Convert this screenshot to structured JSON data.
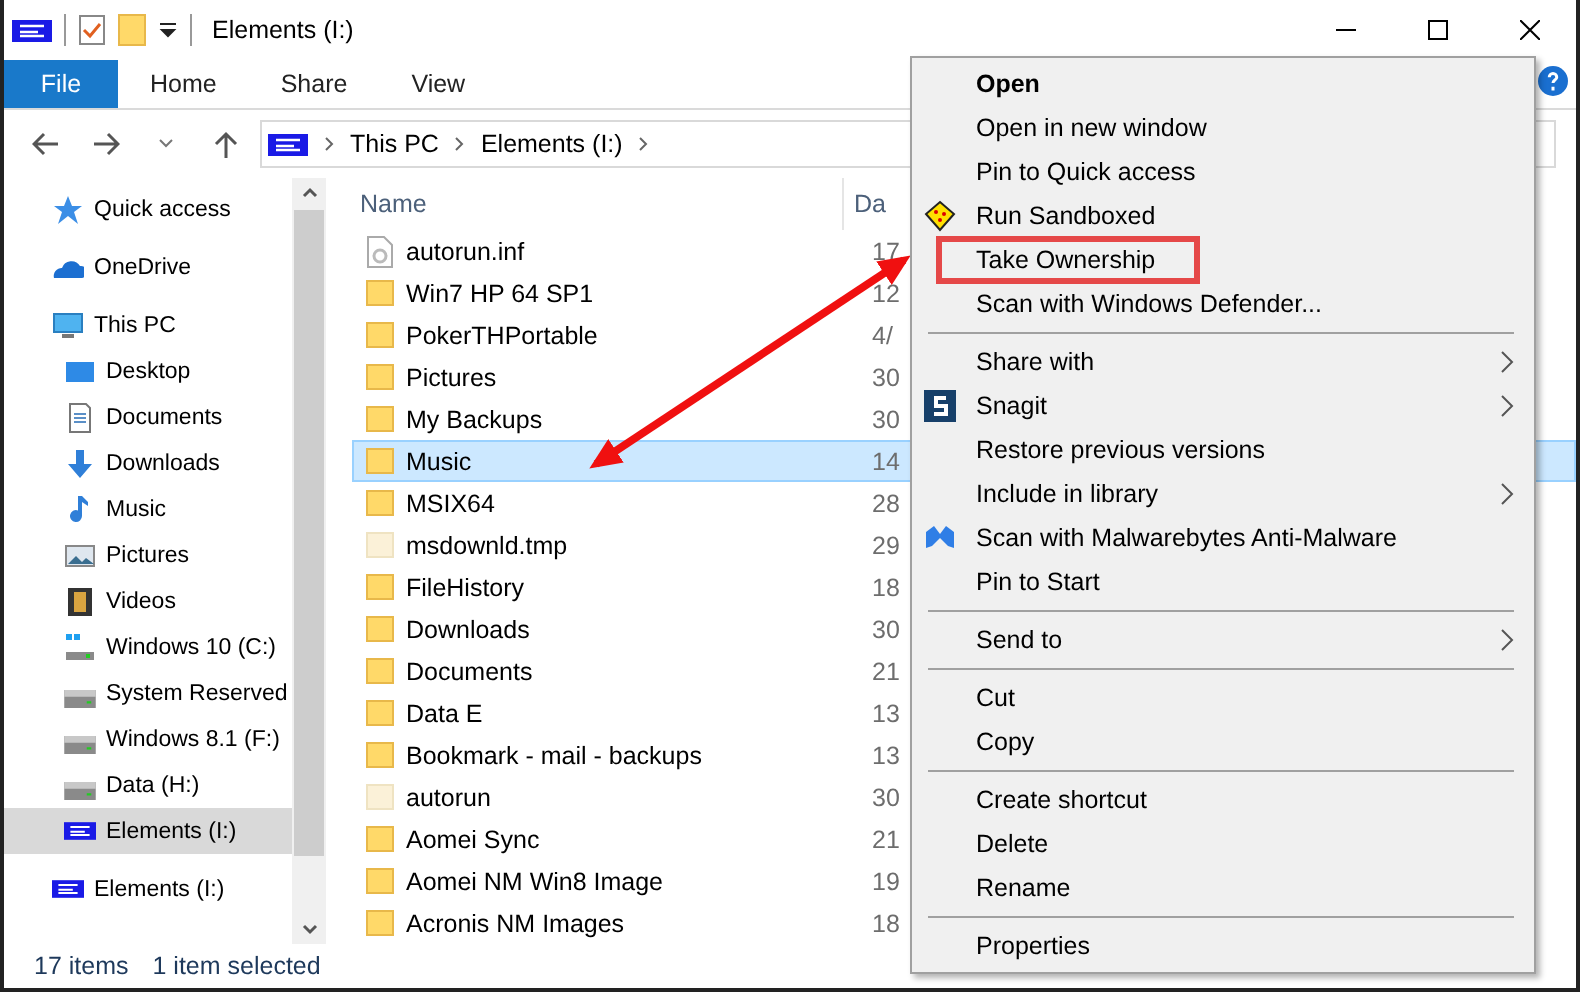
{
  "window": {
    "title": "Elements (I:)"
  },
  "ribbon_tabs": [
    {
      "label": "File",
      "kind": "file"
    },
    {
      "label": "Home",
      "kind": "tab"
    },
    {
      "label": "Share",
      "kind": "tab"
    },
    {
      "label": "View",
      "kind": "tab"
    }
  ],
  "address": {
    "path": [
      "This PC",
      "Elements (I:)"
    ]
  },
  "sidebar": {
    "items": [
      {
        "label": "Quick access",
        "selected": false
      },
      {
        "label": "OneDrive",
        "selected": false
      },
      {
        "label": "This PC",
        "selected": false,
        "children": [
          {
            "label": "Desktop",
            "selected": false
          },
          {
            "label": "Documents",
            "selected": false
          },
          {
            "label": "Downloads",
            "selected": false
          },
          {
            "label": "Music",
            "selected": false
          },
          {
            "label": "Pictures",
            "selected": false
          },
          {
            "label": "Videos",
            "selected": false
          },
          {
            "label": "Windows 10 (C:)",
            "selected": false
          },
          {
            "label": "System Reserved",
            "selected": false
          },
          {
            "label": "Windows 8.1 (F:)",
            "selected": false
          },
          {
            "label": "Data (H:)",
            "selected": false
          },
          {
            "label": "Elements (I:)",
            "selected": true
          }
        ]
      },
      {
        "label": "Elements (I:)",
        "selected": false
      }
    ]
  },
  "file_list": {
    "columns": [
      "Name",
      "Da"
    ],
    "rows": [
      {
        "name": "autorun.inf",
        "date": "17",
        "kind": "file",
        "selected": false
      },
      {
        "name": "Win7 HP 64 SP1",
        "date": "12",
        "kind": "folder",
        "selected": false
      },
      {
        "name": "PokerTHPortable",
        "date": "4/",
        "kind": "folder",
        "selected": false
      },
      {
        "name": "Pictures",
        "date": "30",
        "kind": "folder",
        "selected": false
      },
      {
        "name": "My Backups",
        "date": "30",
        "kind": "folder",
        "selected": false
      },
      {
        "name": "Music",
        "date": "14",
        "kind": "folder",
        "selected": true
      },
      {
        "name": "MSIX64",
        "date": "28",
        "kind": "folder",
        "selected": false
      },
      {
        "name": "msdownld.tmp",
        "date": "29",
        "kind": "hidden",
        "selected": false
      },
      {
        "name": "FileHistory",
        "date": "18",
        "kind": "folder",
        "selected": false
      },
      {
        "name": "Downloads",
        "date": "30",
        "kind": "folder",
        "selected": false
      },
      {
        "name": "Documents",
        "date": "21",
        "kind": "folder",
        "selected": false
      },
      {
        "name": "Data E",
        "date": "13",
        "kind": "folder",
        "selected": false
      },
      {
        "name": "Bookmark - mail - backups",
        "date": "13",
        "kind": "folder",
        "selected": false
      },
      {
        "name": "autorun",
        "date": "30",
        "kind": "hidden",
        "selected": false
      },
      {
        "name": "Aomei Sync",
        "date": "21",
        "kind": "folder",
        "selected": false
      },
      {
        "name": "Aomei NM Win8 Image",
        "date": "19",
        "kind": "folder",
        "selected": false
      },
      {
        "name": "Acronis NM Images",
        "date": "18",
        "kind": "folder",
        "selected": false
      }
    ]
  },
  "status_bar": {
    "item_count": "17 items",
    "selection": "1 item selected"
  },
  "context_menu": {
    "groups": [
      [
        {
          "label": "Open",
          "bold": true
        },
        {
          "label": "Open in new window"
        },
        {
          "label": "Pin to Quick access"
        },
        {
          "label": "Run Sandboxed"
        },
        {
          "label": "Take Ownership",
          "annotated": true
        },
        {
          "label": "Scan with Windows Defender..."
        }
      ],
      [
        {
          "label": "Share with",
          "submenu": true
        },
        {
          "label": "Snagit",
          "submenu": true
        },
        {
          "label": "Restore previous versions"
        },
        {
          "label": "Include in library",
          "submenu": true
        },
        {
          "label": "Scan with Malwarebytes Anti-Malware"
        },
        {
          "label": "Pin to Start"
        }
      ],
      [
        {
          "label": "Send to",
          "submenu": true
        }
      ],
      [
        {
          "label": "Cut"
        },
        {
          "label": "Copy"
        }
      ],
      [
        {
          "label": "Create shortcut"
        },
        {
          "label": "Delete"
        },
        {
          "label": "Rename"
        }
      ],
      [
        {
          "label": "Properties"
        }
      ]
    ]
  }
}
